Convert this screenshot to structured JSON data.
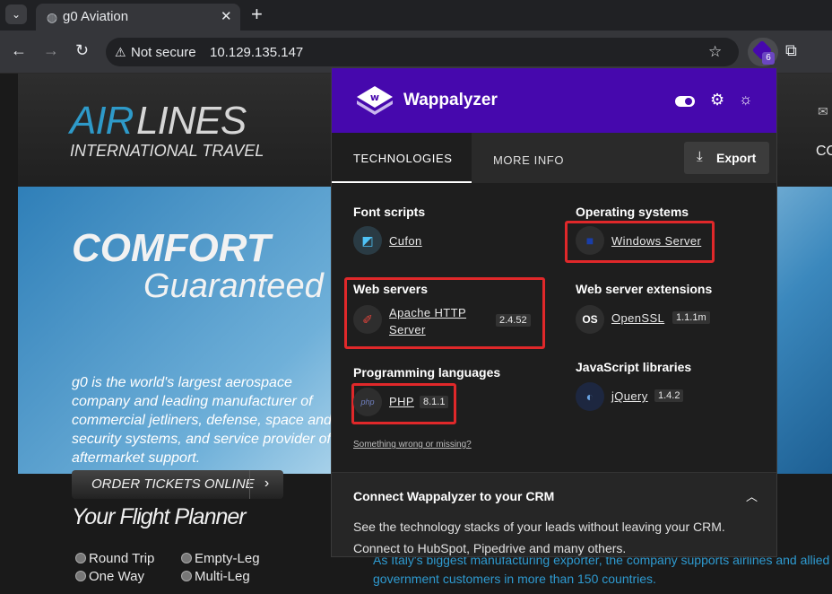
{
  "browser": {
    "tab_title": "g0 Aviation",
    "tab_close": "✕",
    "new_tab": "+",
    "security_label": "Not secure",
    "url": "10.129.135.147",
    "extension_badge": "6",
    "icons": {
      "tab_dropdown": "chevron-down-icon",
      "favicon": "globe-icon",
      "back": "arrow-left-icon",
      "forward": "arrow-right-icon",
      "reload": "reload-icon",
      "security": "warning-triangle-icon",
      "bookmark": "star-icon",
      "extensions": "puzzle-icon"
    }
  },
  "site": {
    "logo_air": "AIR",
    "logo_lines": "LINES",
    "logo_sub": "INTERNATIONAL TRAVEL",
    "hero_title": "COMFORT",
    "hero_subtitle": "Guaranteed",
    "hero_text": "g0 is the world's largest aerospace company and leading manufacturer of commercial jetliners, defense, space and security systems, and service provider of aftermarket support.",
    "order_tickets": "ORDER TICKETS ONLINE",
    "planner_title": "Your Flight Planner",
    "trip_options": [
      "Round Trip",
      "Empty-Leg",
      "One Way",
      "Multi-Leg"
    ],
    "nav_contact": "CONT",
    "footer_text": "As Italy's biggest manufacturing exporter, the company supports airlines and allied government customers in more than 150 countries."
  },
  "wappalyzer": {
    "title": "Wappalyzer",
    "tabs": [
      "TECHNOLOGIES",
      "MORE INFO"
    ],
    "export_label": "Export",
    "categories": [
      {
        "name": "Font scripts",
        "items": [
          {
            "name": "Cufon",
            "version": "",
            "icon": "cufon-icon"
          }
        ]
      },
      {
        "name": "Operating systems",
        "items": [
          {
            "name": "Windows Server",
            "version": "",
            "icon": "windows-icon"
          }
        ]
      },
      {
        "name": "Web servers",
        "items": [
          {
            "name": "Apache HTTP Server",
            "version": "2.4.52",
            "icon": "apache-feather-icon"
          }
        ]
      },
      {
        "name": "Web server extensions",
        "items": [
          {
            "name": "OpenSSL",
            "version": "1.1.1m",
            "icon": "openssl-icon"
          }
        ]
      },
      {
        "name": "Programming languages",
        "items": [
          {
            "name": "PHP",
            "version": "8.1.1",
            "icon": "php-icon"
          }
        ]
      },
      {
        "name": "JavaScript libraries",
        "items": [
          {
            "name": "jQuery",
            "version": "1.4.2",
            "icon": "jquery-icon"
          }
        ]
      }
    ],
    "report_link": "Something wrong or missing?",
    "crm_title": "Connect Wappalyzer to your CRM",
    "crm_text": "See the technology stacks of your leads without leaving your CRM. Connect to HubSpot, Pipedrive and many others.",
    "colors": {
      "header": "#4608ad",
      "highlight": "#e0282a"
    }
  }
}
